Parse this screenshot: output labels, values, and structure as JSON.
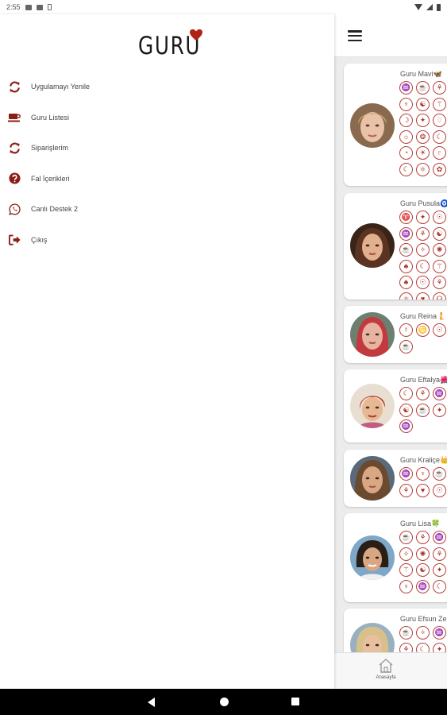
{
  "status_bar": {
    "time": "2:55"
  },
  "drawer": {
    "logo_text": "GURU",
    "menu": [
      {
        "label": "Uygulamayı Yenile",
        "icon": "refresh-icon"
      },
      {
        "label": "Guru Listesi",
        "icon": "coffee-cup-icon"
      },
      {
        "label": "Siparişlerim",
        "icon": "sync-icon"
      },
      {
        "label": "Fal İçerikleri",
        "icon": "question-icon"
      },
      {
        "label": "Canlı Destek 2",
        "icon": "whatsapp-icon"
      },
      {
        "label": "Çıkış",
        "icon": "sign-out-icon"
      }
    ]
  },
  "gurus": [
    {
      "name": "Guru Mavi🦋",
      "icons": [
        "♒",
        "☕",
        "⚘",
        "♆",
        "☯",
        "⚚",
        "☽",
        "✦",
        "♢",
        "☼",
        "❂",
        "☾",
        "◔",
        "☀",
        "♇",
        "☾",
        "⚛",
        "✿"
      ]
    },
    {
      "name": "Guru Pusula🧿",
      "icons": [
        "♈",
        "✦",
        "☉",
        "♒",
        "⚘",
        "☯",
        "☕",
        "✧",
        "✺",
        "♣",
        "☾",
        "⚚",
        "♣",
        "☉",
        "⚘",
        "⚛",
        "♥",
        "☊"
      ]
    },
    {
      "name": "Guru Reina🧜",
      "icons": [
        "☿",
        "♋",
        "☉",
        "☕"
      ]
    },
    {
      "name": "Guru Eftalya🌺",
      "icons": [
        "☾",
        "⚘",
        "♒",
        "☯",
        "☕",
        "✦",
        "♒"
      ]
    },
    {
      "name": "Guru Kraliçe👑",
      "icons": [
        "♒",
        "♆",
        "☕",
        "⚘",
        "♥",
        "☉"
      ]
    },
    {
      "name": "Guru Lisa🍀",
      "icons": [
        "☕",
        "⚘",
        "♒",
        "✧",
        "✺",
        "⚘",
        "⚚",
        "☯",
        "✦",
        "♆",
        "♒",
        "☾"
      ]
    },
    {
      "name": "Guru Efsun Ze",
      "icons": [
        "☕",
        "✧",
        "♒",
        "⚘",
        "☾",
        "✦"
      ]
    }
  ],
  "bottom_nav": {
    "home_label": "Anasayfa"
  },
  "colors": {
    "accent": "#a8322c",
    "drawer_icon": "#8b1e14",
    "heart": "#b02418"
  }
}
